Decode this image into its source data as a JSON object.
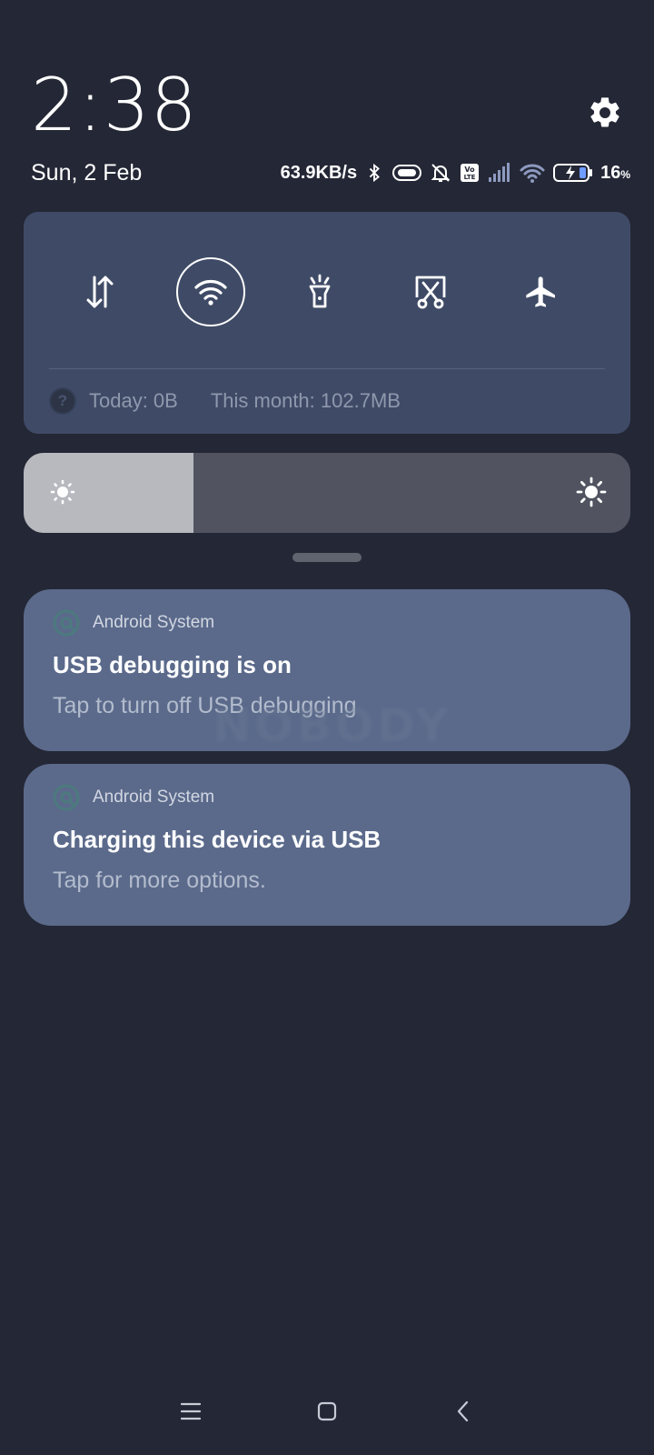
{
  "header": {
    "time": "2:38",
    "date": "Sun, 2 Feb",
    "network_speed": "63.9KB/s",
    "battery_percent": "16",
    "battery_unit": "%",
    "status_icons": [
      "bluetooth-icon",
      "vibrate-icon",
      "silent-bell-icon",
      "volte-icon",
      "signal-icon",
      "wifi-icon",
      "battery-charging-icon"
    ]
  },
  "quick_settings": {
    "tiles": [
      {
        "name": "mobile-data",
        "icon": "data-arrows-icon",
        "active": false
      },
      {
        "name": "wifi",
        "icon": "wifi-icon",
        "active": true
      },
      {
        "name": "flashlight",
        "icon": "flashlight-icon",
        "active": false
      },
      {
        "name": "screenshot",
        "icon": "screenshot-scissors-icon",
        "active": false
      },
      {
        "name": "airplane-mode",
        "icon": "airplane-icon",
        "active": false
      }
    ],
    "data_today": "Today: 0B",
    "data_month": "This month: 102.7MB"
  },
  "brightness": {
    "level": 0.28
  },
  "notifications": [
    {
      "app": "Android System",
      "title": "USB debugging is on",
      "text": "Tap to turn off USB debugging"
    },
    {
      "app": "Android System",
      "title": "Charging this device via USB",
      "text": "Tap for more options."
    }
  ],
  "watermark": "NOBODY",
  "colors": {
    "background": "#242735",
    "panel": "#3f4b66",
    "notification": "#5b6a8b",
    "accent_white": "#ffffff"
  }
}
